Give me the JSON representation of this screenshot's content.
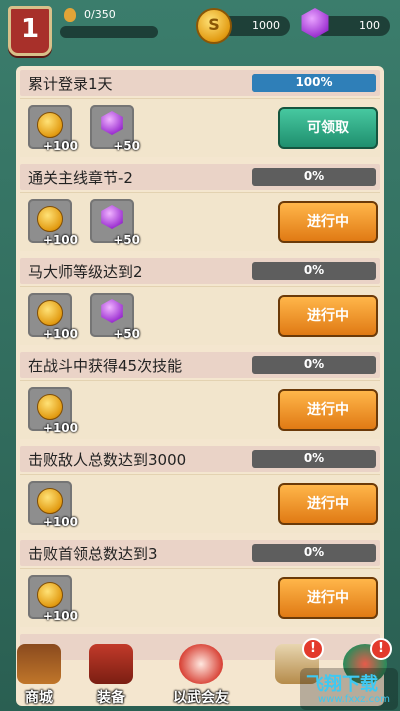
{
  "header": {
    "level": "1",
    "xp_text": "0/350",
    "xp_progress": 0,
    "gold": "1000",
    "gems": "100"
  },
  "tasks": [
    {
      "title": "累计登录1天",
      "progress_text": "100%",
      "progress": 1.0,
      "rewards": [
        {
          "icon": "coin-icon",
          "amount": "+100"
        },
        {
          "icon": "gem-icon",
          "amount": "+50"
        }
      ],
      "button": "可领取",
      "state": "claimable"
    },
    {
      "title": "通关主线章节-2",
      "progress_text": "0%",
      "progress": 0,
      "rewards": [
        {
          "icon": "coin-icon",
          "amount": "+100"
        },
        {
          "icon": "gem-icon",
          "amount": "+50"
        }
      ],
      "button": "进行中",
      "state": "in-progress"
    },
    {
      "title": "马大师等级达到2",
      "progress_text": "0%",
      "progress": 0,
      "rewards": [
        {
          "icon": "coin-icon",
          "amount": "+100"
        },
        {
          "icon": "gem-icon",
          "amount": "+50"
        }
      ],
      "button": "进行中",
      "state": "in-progress"
    },
    {
      "title": "在战斗中获得45次技能",
      "progress_text": "0%",
      "progress": 0,
      "rewards": [
        {
          "icon": "coin-icon",
          "amount": "+100"
        }
      ],
      "button": "进行中",
      "state": "in-progress"
    },
    {
      "title": "击败敌人总数达到3000",
      "progress_text": "0%",
      "progress": 0,
      "rewards": [
        {
          "icon": "coin-icon",
          "amount": "+100"
        }
      ],
      "button": "进行中",
      "state": "in-progress"
    },
    {
      "title": "击败首领总数达到3",
      "progress_text": "0%",
      "progress": 0,
      "rewards": [
        {
          "icon": "coin-icon",
          "amount": "+100"
        }
      ],
      "button": "进行中",
      "state": "in-progress"
    }
  ],
  "bottom_nav": {
    "items": [
      {
        "label": "商城",
        "icon": "shop-icon"
      },
      {
        "label": "装备",
        "icon": "equipment-icon"
      },
      {
        "label": "以武会友",
        "icon": "martial-friends-icon"
      }
    ],
    "badge": "!"
  },
  "watermark": {
    "text": "飞翔下载",
    "url": "www.fxxz.com"
  },
  "colors": {
    "accent_green": "#1f8f6e",
    "accent_orange": "#e07a14",
    "progress_blue": "#2f7fb8"
  }
}
